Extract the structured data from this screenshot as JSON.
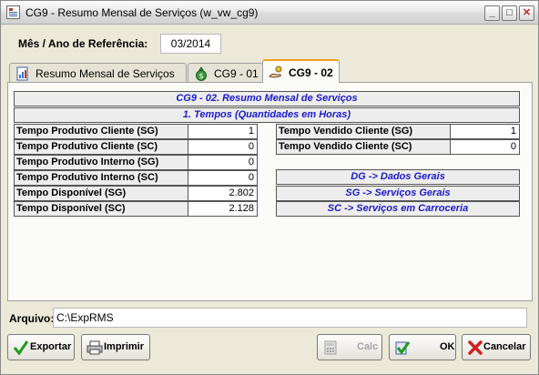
{
  "window": {
    "title": "CG9 -  Resumo Mensal de Serviços (w_vw_cg9)",
    "controls": [
      "_",
      "□",
      "✕"
    ]
  },
  "reference": {
    "label": "Mês / Ano de Referência:",
    "value": "03/2014"
  },
  "tabs": [
    {
      "label": "Resumo Mensal de Serviços",
      "icon": "document-chart-icon"
    },
    {
      "label": "CG9 - 01",
      "icon": "money-bag-icon"
    },
    {
      "label": "CG9 - 02",
      "icon": "hand-coins-icon",
      "active": true
    }
  ],
  "panel": {
    "header1": "CG9 - 02. Resumo Mensal de Serviços",
    "header2": "1. Tempos (Quantidades em Horas)",
    "left_rows": [
      {
        "label": "Tempo Produtivo Cliente (SG)",
        "value": "1"
      },
      {
        "label": "Tempo Produtivo Cliente (SC)",
        "value": "0"
      },
      {
        "label": "Tempo Produtivo Interno (SG)",
        "value": "0"
      },
      {
        "label": "Tempo Produtivo Interno (SC)",
        "value": "0"
      },
      {
        "label": "Tempo Disponível (SG)",
        "value": "2.802"
      },
      {
        "label": "Tempo Disponível (SC)",
        "value": "2.128"
      }
    ],
    "right_rows": [
      {
        "label": "Tempo Vendido Cliente (SG)",
        "value": "1"
      },
      {
        "label": "Tempo Vendido Cliente (SC)",
        "value": "0"
      }
    ],
    "legend": [
      "DG -> Dados Gerais",
      "SG -> Serviços Gerais",
      "SC -> Serviços em Carroceria"
    ]
  },
  "file": {
    "label": "Arquivo:",
    "value": "C:\\ExpRMS"
  },
  "buttons": {
    "exportar": {
      "label": "Exportar",
      "icon": "check-icon"
    },
    "imprimir": {
      "label": "Imprimir",
      "icon": "printer-icon"
    },
    "calc": {
      "label": "Calc",
      "icon": "calculator-icon",
      "disabled": true
    },
    "ok": {
      "label": "OK",
      "icon": "ok-icon"
    },
    "cancelar": {
      "label": "Cancelar",
      "icon": "cancel-icon"
    }
  },
  "colors": {
    "accent_text": "#1a1acc",
    "active_tab_border": "#f0a020"
  }
}
